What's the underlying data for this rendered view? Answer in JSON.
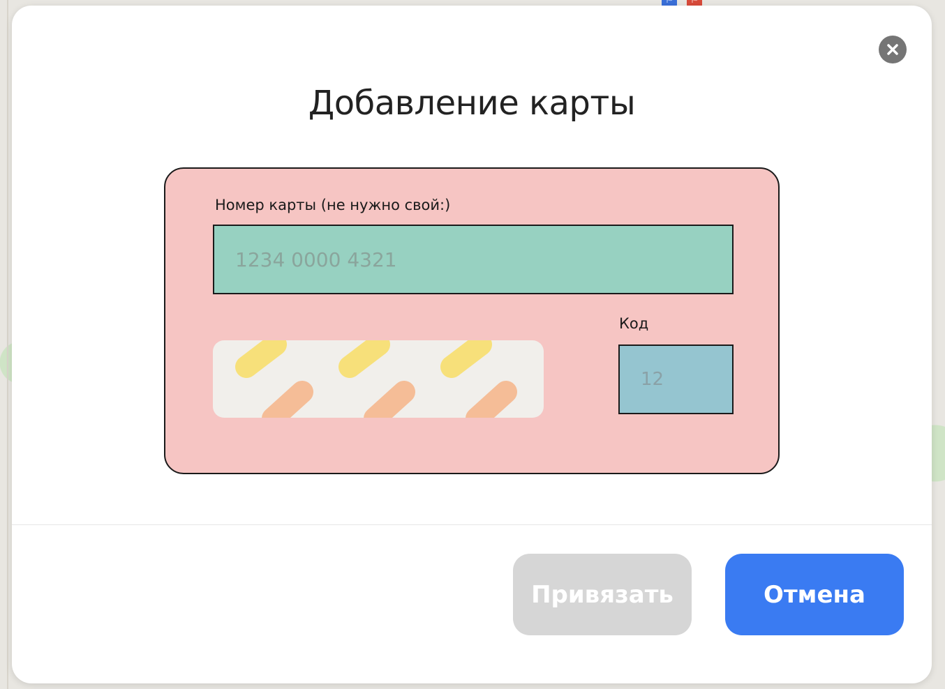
{
  "dialog": {
    "title": "Добавление карты",
    "close_icon": "close-icon"
  },
  "card": {
    "number_label": "Номер карты (не нужно свой:)",
    "number_placeholder": "1234 0000 4321",
    "code_label": "Код",
    "code_placeholder": "12",
    "colors": {
      "card_bg": "#f6c5c3",
      "number_field_bg": "#97d1c1",
      "code_field_bg": "#95c5d0",
      "stripe_bg": "#f1efeb",
      "stripe_yellow": "#f7e07a",
      "stripe_orange": "#f5bd97"
    }
  },
  "actions": {
    "bind_label": "Привязать",
    "cancel_label": "Отмена",
    "bind_disabled": true,
    "colors": {
      "bind_bg": "#d6d6d6",
      "cancel_bg": "#3a7bf2"
    }
  }
}
